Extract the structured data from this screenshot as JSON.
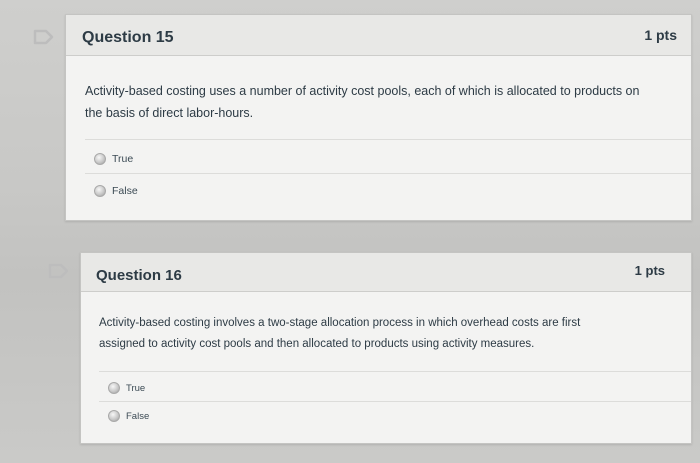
{
  "questions": [
    {
      "title": "Question 15",
      "points": "1 pts",
      "text_line1": "Activity-based costing uses a number of activity cost pools, each of which is allocated to products on",
      "text_line2": "the basis of direct labor-hours.",
      "answers": [
        "True",
        "False"
      ]
    },
    {
      "title": "Question 16",
      "points": "1 pts",
      "text_line1": "Activity-based costing involves a two-stage allocation process in which overhead costs are first",
      "text_line2": "assigned to activity cost pools and then allocated to products using activity measures.",
      "answers": [
        "True",
        "False"
      ]
    }
  ],
  "colors": {
    "flag_outline": "#bfbfbf",
    "card_bg": "#f3f3f2",
    "header_bg": "#e8e8e6"
  },
  "icons": {
    "flag": "bookmark-flag-icon"
  }
}
